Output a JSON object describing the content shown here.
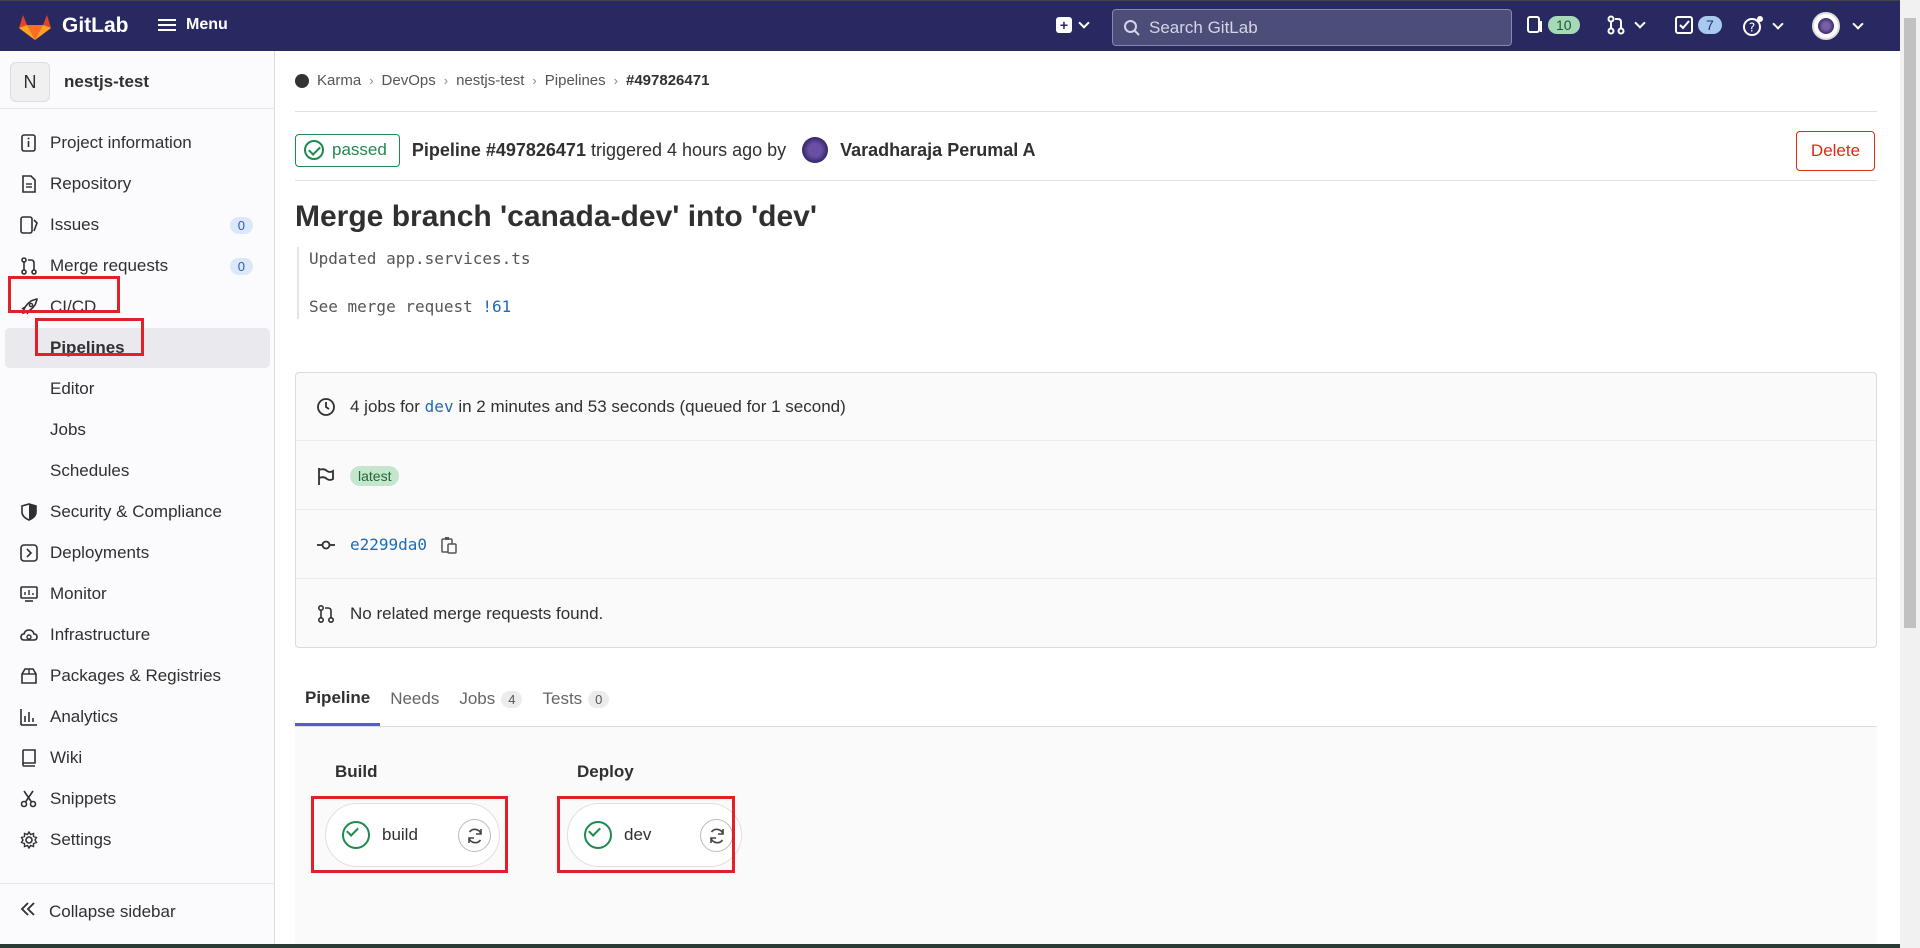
{
  "topbar": {
    "brand": "GitLab",
    "menu_label": "Menu",
    "search_placeholder": "Search GitLab",
    "issues_count": "10",
    "todos_count": "7"
  },
  "sidebar": {
    "project_initial": "N",
    "project_name": "nestjs-test",
    "items": [
      {
        "label": "Project information",
        "icon": "info-icon"
      },
      {
        "label": "Repository",
        "icon": "document-icon"
      },
      {
        "label": "Issues",
        "icon": "issues-icon",
        "count": "0"
      },
      {
        "label": "Merge requests",
        "icon": "merge-request-icon",
        "count": "0"
      },
      {
        "label": "CI/CD",
        "icon": "rocket-icon"
      },
      {
        "label": "Pipelines"
      },
      {
        "label": "Editor"
      },
      {
        "label": "Jobs"
      },
      {
        "label": "Schedules"
      },
      {
        "label": "Security & Compliance",
        "icon": "shield-icon"
      },
      {
        "label": "Deployments",
        "icon": "deployments-icon"
      },
      {
        "label": "Monitor",
        "icon": "monitor-icon"
      },
      {
        "label": "Infrastructure",
        "icon": "cloud-gear-icon"
      },
      {
        "label": "Packages & Registries",
        "icon": "package-icon"
      },
      {
        "label": "Analytics",
        "icon": "chart-icon"
      },
      {
        "label": "Wiki",
        "icon": "book-icon"
      },
      {
        "label": "Snippets",
        "icon": "scissors-icon"
      },
      {
        "label": "Settings",
        "icon": "gear-icon"
      }
    ],
    "collapse_label": "Collapse sidebar"
  },
  "breadcrumb": [
    "Karma",
    "DevOps",
    "nestjs-test",
    "Pipelines",
    "#497826471"
  ],
  "pipeline": {
    "status": "passed",
    "title": "Pipeline #497826471",
    "triggered": "triggered 4 hours ago by",
    "user": "Varadharaja Perumal A",
    "delete_label": "Delete"
  },
  "commit": {
    "title": "Merge branch 'canada-dev' into 'dev'",
    "desc_line1": "Updated app.services.ts",
    "desc_line2_prefix": "See merge request",
    "mr_link": "!61"
  },
  "info": {
    "jobs_prefix": "4 jobs for",
    "branch": "dev",
    "jobs_suffix": "in 2 minutes and 53 seconds (queued for 1 second)",
    "tag": "latest",
    "sha": "e2299da0",
    "merge_requests": "No related merge requests found."
  },
  "tabs": [
    {
      "label": "Pipeline"
    },
    {
      "label": "Needs"
    },
    {
      "label": "Jobs",
      "count": "4"
    },
    {
      "label": "Tests",
      "count": "0"
    }
  ],
  "graph": {
    "stages": [
      {
        "name": "Build",
        "job": "build"
      },
      {
        "name": "Deploy",
        "job": "dev"
      }
    ]
  },
  "colors": {
    "nav_bg": "#292961",
    "success": "#1e8a4e",
    "danger": "#dd2b0e",
    "highlight_box": "#e02128",
    "link": "#1f6bb3"
  }
}
